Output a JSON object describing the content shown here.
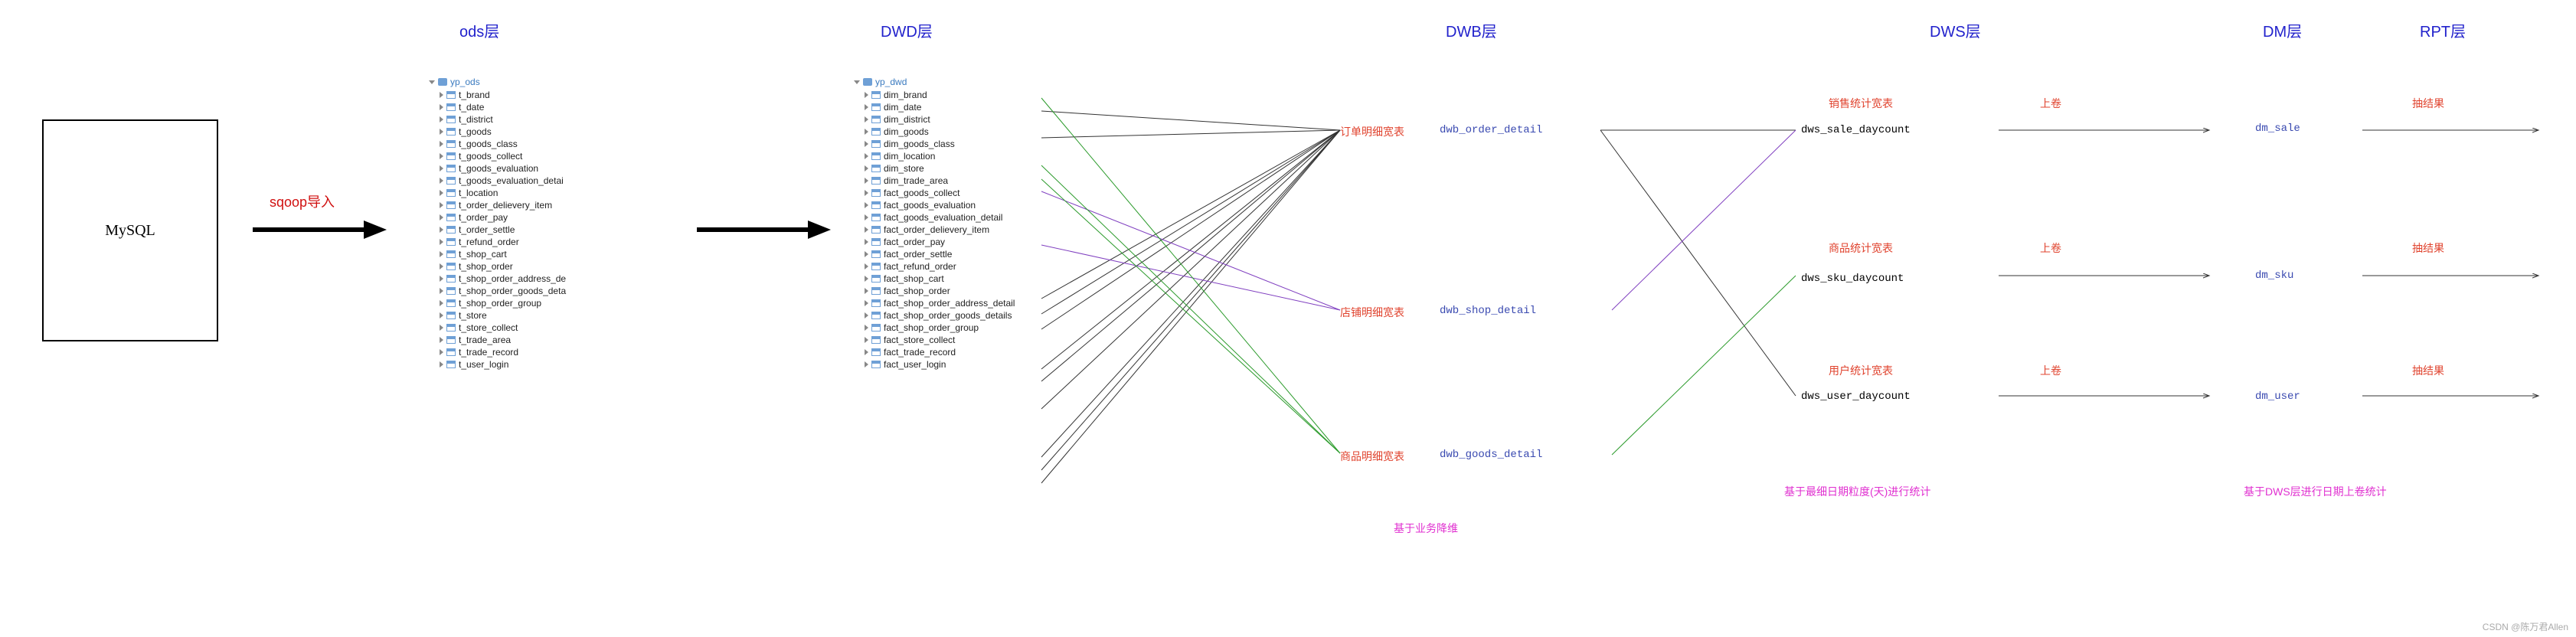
{
  "layers": {
    "source_db": "MySQL",
    "sqoop_label": "sqoop导入",
    "ods": "ods层",
    "dwd": "DWD层",
    "dwb": "DWB层",
    "dws": "DWS层",
    "dm": "DM层",
    "rpt": "RPT层"
  },
  "ods_db": "yp_ods",
  "ods_tables": [
    "t_brand",
    "t_date",
    "t_district",
    "t_goods",
    "t_goods_class",
    "t_goods_collect",
    "t_goods_evaluation",
    "t_goods_evaluation_detai",
    "t_location",
    "t_order_delievery_item",
    "t_order_pay",
    "t_order_settle",
    "t_refund_order",
    "t_shop_cart",
    "t_shop_order",
    "t_shop_order_address_de",
    "t_shop_order_goods_deta",
    "t_shop_order_group",
    "t_store",
    "t_store_collect",
    "t_trade_area",
    "t_trade_record",
    "t_user_login"
  ],
  "dwd_db": "yp_dwd",
  "dwd_tables": [
    "dim_brand",
    "dim_date",
    "dim_district",
    "dim_goods",
    "dim_goods_class",
    "dim_location",
    "dim_store",
    "dim_trade_area",
    "fact_goods_collect",
    "fact_goods_evaluation",
    "fact_goods_evaluation_detail",
    "fact_order_delievery_item",
    "fact_order_pay",
    "fact_order_settle",
    "fact_refund_order",
    "fact_shop_cart",
    "fact_shop_order",
    "fact_shop_order_address_detail",
    "fact_shop_order_goods_details",
    "fact_shop_order_group",
    "fact_store_collect",
    "fact_trade_record",
    "fact_user_login"
  ],
  "dwb": {
    "order": {
      "label": "订单明细宽表",
      "name": "dwb_order_detail"
    },
    "shop": {
      "label": "店铺明细宽表",
      "name": "dwb_shop_detail"
    },
    "goods": {
      "label": "商品明细宽表",
      "name": "dwb_goods_detail"
    },
    "note": "基于业务降维"
  },
  "dws": {
    "sale": {
      "label": "销售统计宽表",
      "name": "dws_sale_daycount"
    },
    "sku": {
      "label": "商品统计宽表",
      "name": "dws_sku_daycount"
    },
    "user": {
      "label": "用户统计宽表",
      "name": "dws_user_daycount"
    },
    "note": "基于最细日期粒度(天)进行统计"
  },
  "uproll": "上卷",
  "dm": {
    "sale": "dm_sale",
    "sku": "dm_sku",
    "user": "dm_user",
    "note": "基于DWS层进行日期上卷统计"
  },
  "rpt_label": "抽结果",
  "watermark": "CSDN @陈万君Allen"
}
